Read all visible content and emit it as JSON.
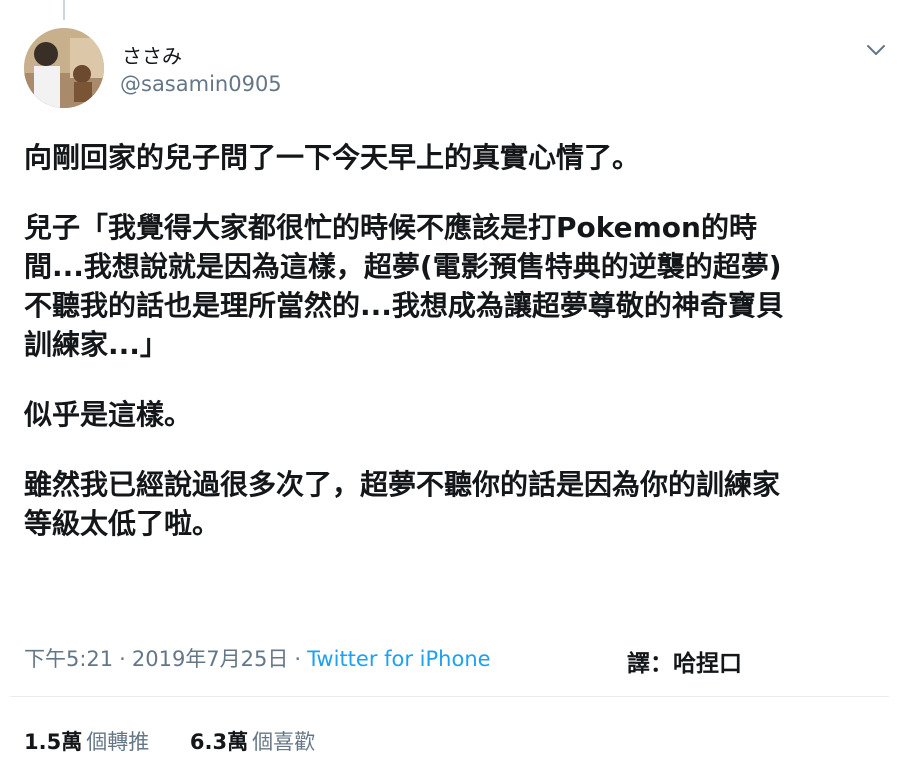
{
  "user": {
    "display_name": "ささみ",
    "handle": "@sasamin0905"
  },
  "tweet": {
    "paragraphs": [
      "向剛回家的兒子問了一下今天早上的真實心情了。",
      "兒子「我覺得大家都很忙的時候不應該是打Pokemon的時\n間...我想說就是因為這樣，超夢(電影預售特典的逆襲的超夢)\n不聽我的話也是理所當然的...我想成為讓超夢尊敬的神奇寶貝\n訓練家...」",
      "似乎是這樣。",
      "雖然我已經說過很多次了，超夢不聽你的話是因為你的訓練家\n等級太低了啦。"
    ]
  },
  "meta": {
    "time": "下午5:21",
    "separator": "·",
    "date": "2019年7月25日",
    "source": "Twitter for iPhone",
    "translator": "譯：哈捏口"
  },
  "stats": {
    "retweets_count": "1.5萬",
    "retweets_label": "個轉推",
    "likes_count": "6.3萬",
    "likes_label": "個喜歡"
  },
  "icons": {
    "caret": "chevron-down-icon",
    "avatar": "avatar-photo"
  }
}
